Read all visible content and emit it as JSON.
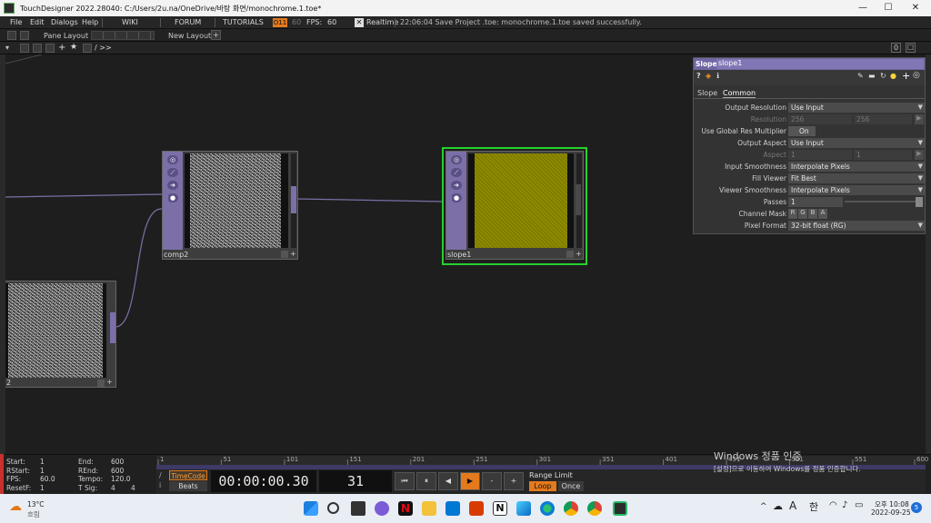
{
  "window": {
    "title": "TouchDesigner 2022.28040: C:/Users/2u.na/OneDrive/바탕 화면/monochrome.1.toe*",
    "minimize": "—",
    "maximize": "☐",
    "close": "✕"
  },
  "menubar": {
    "items": [
      "File",
      "Edit",
      "Dialogs",
      "Help"
    ],
    "wiki": "WIKI",
    "forum": "FORUM",
    "tutorials": "TUTORIALS",
    "perf_badge": "O11",
    "fps_dim": "60",
    "fps_label": "FPS:",
    "fps_value": "60",
    "realtime_check": "✕",
    "realtime_label": "Realtime",
    "status": "22:06:04 Save Project .toe: monochrome.1.toe saved successfully."
  },
  "panebar": {
    "pane_layout": "Pane Layout",
    "new_layout": "New Layout",
    "add": "+"
  },
  "pathbar": {
    "path": "/ >>",
    "right_0": "0",
    "right_1": "☐"
  },
  "network": {
    "nodes": [
      {
        "name": "comp2"
      },
      {
        "name": "slope1"
      },
      {
        "name": "2"
      }
    ]
  },
  "params": {
    "op_type": "Slope",
    "op_name": "slope1",
    "tabs": [
      "Slope",
      "Common"
    ],
    "rows": [
      {
        "label": "Output Resolution",
        "value": "Use Input",
        "dim": false,
        "menu": true
      },
      {
        "label": "Resolution",
        "value": "256",
        "value2": "256",
        "dim": true,
        "menu": false
      },
      {
        "label": "Use Global Res Multiplier",
        "value": "On",
        "dim": false,
        "toggle": true
      },
      {
        "label": "Output Aspect",
        "value": "Use Input",
        "dim": false,
        "menu": true
      },
      {
        "label": "Aspect",
        "value": "1",
        "value2": "1",
        "dim": true,
        "menu": false
      },
      {
        "label": "Input Smoothness",
        "value": "Interpolate Pixels",
        "dim": false,
        "menu": true
      },
      {
        "label": "Fill Viewer",
        "value": "Fit Best",
        "dim": false,
        "menu": true
      },
      {
        "label": "Viewer Smoothness",
        "value": "Interpolate Pixels",
        "dim": false,
        "menu": true
      },
      {
        "label": "Passes",
        "value": "1",
        "dim": false,
        "menu": false
      },
      {
        "label": "Channel Mask",
        "value": "",
        "dim": false,
        "mask": [
          "R",
          "G",
          "B",
          "A"
        ]
      },
      {
        "label": "Pixel Format",
        "value": "32-bit float (RG)",
        "dim": false,
        "menu": true
      }
    ]
  },
  "timeline": {
    "start_label": "Start:",
    "start": "1",
    "end_label": "End:",
    "end": "600",
    "rstart_label": "RStart:",
    "rstart": "1",
    "rend_label": "REnd:",
    "rend": "600",
    "fps_label": "FPS:",
    "fps": "60.0",
    "tempo_label": "Tempo:",
    "tempo": "120.0",
    "resetf_label": "ResetF:",
    "resetf": "1",
    "tsig_label": "T Sig:",
    "tsig_a": "4",
    "tsig_b": "4",
    "ticks": [
      "1",
      "51",
      "101",
      "151",
      "201",
      "251",
      "301",
      "351",
      "401",
      "451",
      "501",
      "551",
      "600"
    ],
    "timecode_btn": "TimeCode",
    "beats_btn": "Beats",
    "timecode": "00:00:00.30",
    "frame": "31",
    "range_limit": "Range Limit",
    "loop": "Loop",
    "once": "Once",
    "minus": "-",
    "plus": "+"
  },
  "watermark": {
    "line1": "Windows 정품 인증",
    "line2": "[설정]으로 이동하여 Windows를 정품 인증합니다."
  },
  "taskbar": {
    "temp": "13°C",
    "weather": "흐림",
    "lang_a": "A",
    "lang_ko": "한",
    "time": "오후 10:08",
    "date": "2022-09-25",
    "notif": "5"
  }
}
